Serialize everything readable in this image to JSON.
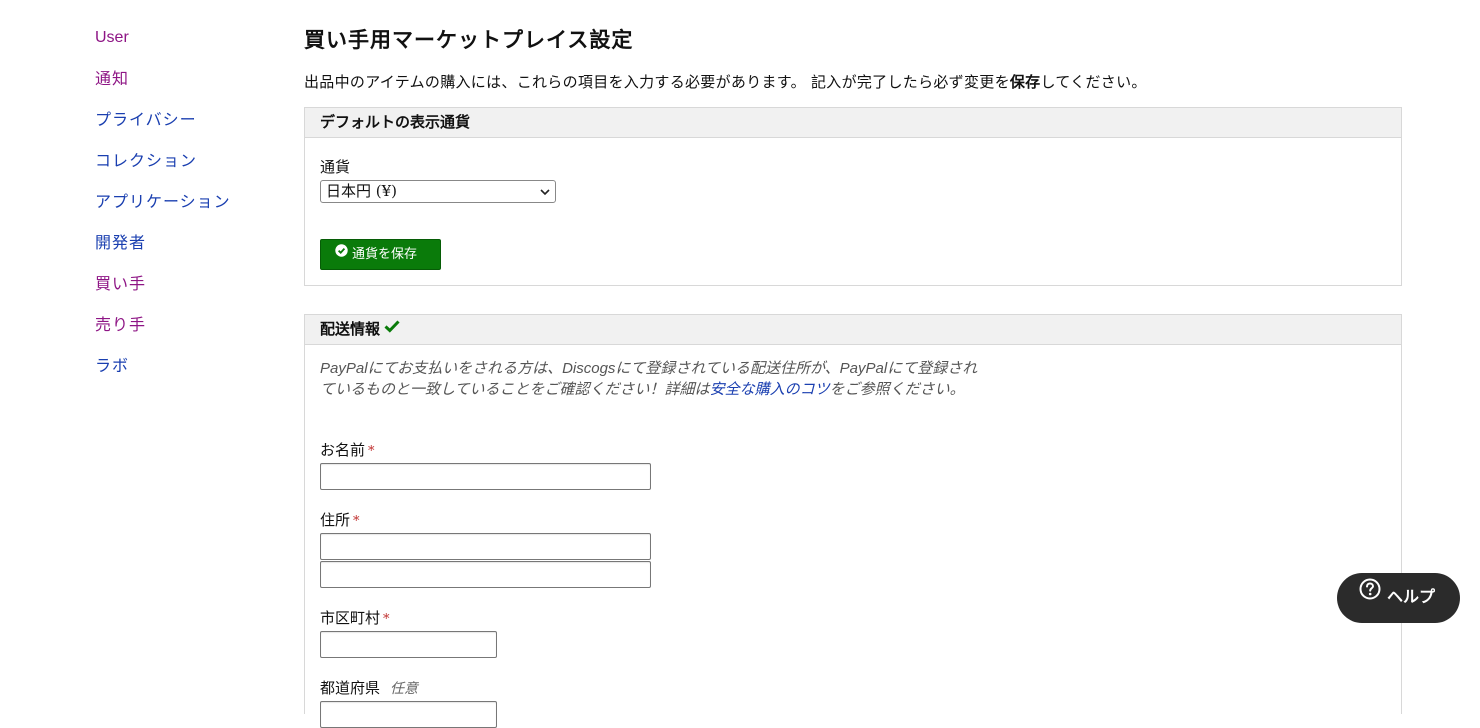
{
  "sidebar": {
    "items": [
      {
        "label": "User"
      },
      {
        "label": "通知"
      },
      {
        "label": "プライバシー"
      },
      {
        "label": "コレクション"
      },
      {
        "label": "アプリケーション"
      },
      {
        "label": "開発者"
      },
      {
        "label": "買い手"
      },
      {
        "label": "売り手"
      },
      {
        "label": "ラボ"
      }
    ]
  },
  "page": {
    "title": "買い手用マーケットプレイス設定",
    "intro_before": "出品中のアイテムの購入には、これらの項目を入力する必要があります。 記入が完了したら必ず変更を",
    "intro_bold": "保存",
    "intro_after": "してください。"
  },
  "currency_panel": {
    "header": "デフォルトの表示通貨",
    "currency_label": "通貨",
    "currency_selected": "日本円 (¥)",
    "save_button": "通貨を保存"
  },
  "shipping_panel": {
    "header": "配送情報",
    "note_before": "PayPalにてお支払いをされる方は、Discogsにて登録されている配送住所が、PayPalにて登録されているものと一致していることをご確認ください！詳細は",
    "note_link": "安全な購入のコツ",
    "note_after": "をご参照ください。",
    "name_label": "お名前",
    "address_label": "住所",
    "city_label": "市区町村",
    "prefecture_label": "都道府県",
    "required_mark": "*",
    "optional_mark": "任意"
  },
  "help_button": {
    "label": "ヘルプ"
  },
  "colors": {
    "link_purple": "#8e1585",
    "link_blue": "#1a3fb0",
    "button_green": "#0a7b0a",
    "help_dark": "#2b2b2b"
  }
}
